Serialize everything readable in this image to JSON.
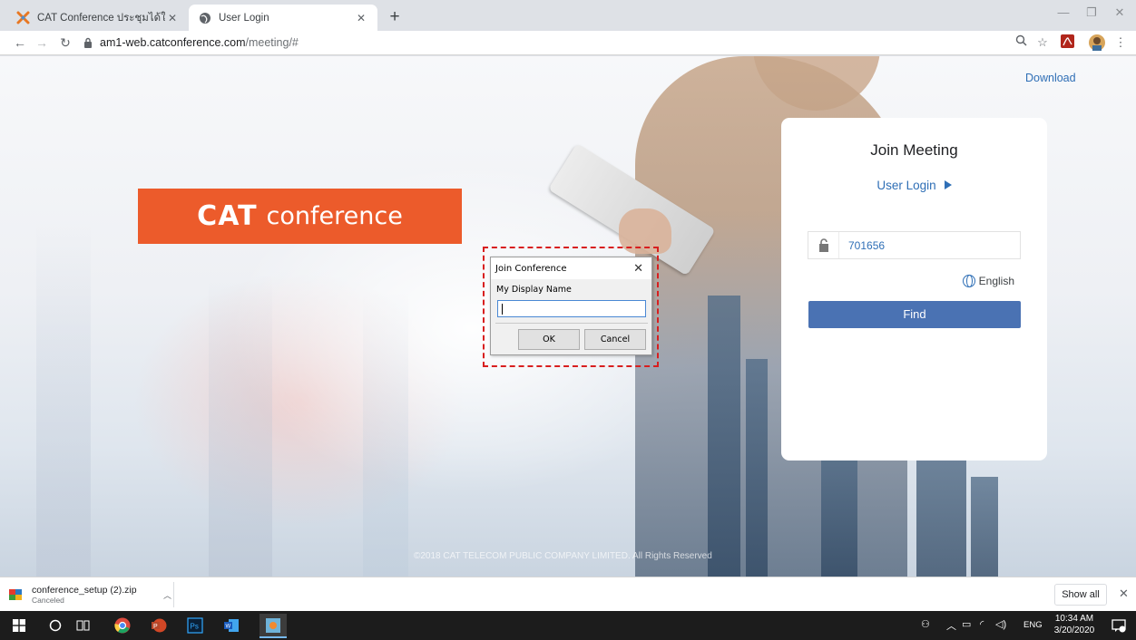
{
  "browser": {
    "tabs": [
      {
        "label": "CAT Conference ประชุมได้ใช้ชีดจำกั",
        "favicon": "joomla-x-icon",
        "active": false
      },
      {
        "label": "User Login",
        "favicon": "globe-icon",
        "active": true
      }
    ],
    "address": {
      "domain": "am1-web.catconference.com",
      "path": "/meeting/#"
    }
  },
  "page": {
    "download_link": "Download",
    "logo": {
      "brand": "CAT",
      "word": "conference",
      "color": "#ec5b2b"
    },
    "footer": "©2018 CAT TELECOM PUBLIC COMPANY LIMITED. All Rights Reserved",
    "join_panel": {
      "title": "Join Meeting",
      "user_login": "User Login",
      "meeting_id": "701656",
      "language": "English",
      "find_button": "Find",
      "accent": "#4a72b3"
    }
  },
  "dialog": {
    "title": "Join Conference",
    "field_label": "My Display Name",
    "field_value": "",
    "ok": "OK",
    "cancel": "Cancel",
    "highlight_color": "#d81f1f"
  },
  "download_bar": {
    "file_name": "conference_setup (2).zip",
    "status": "Canceled",
    "show_all": "Show all"
  },
  "taskbar": {
    "language": "ENG",
    "time": "10:34 AM",
    "date": "3/20/2020"
  }
}
